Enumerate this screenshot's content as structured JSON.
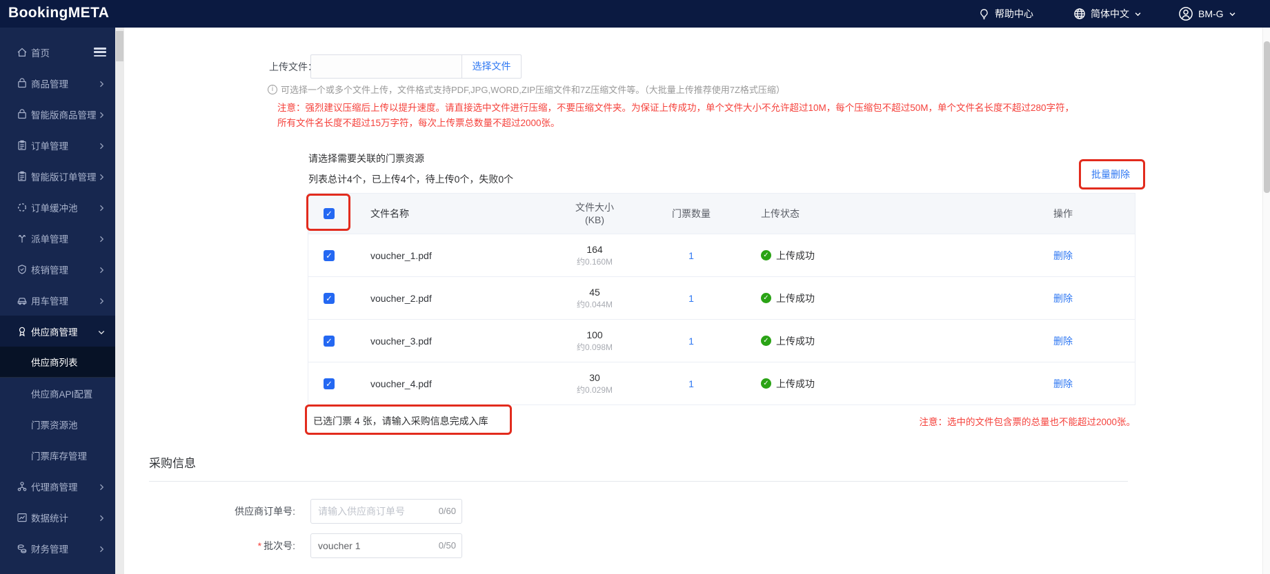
{
  "header": {
    "logo": "BookingMETA",
    "help_label": "帮助中心",
    "language_label": "简体中文",
    "user_label": "BM-G"
  },
  "sidebar": {
    "items": [
      {
        "label": "首页"
      },
      {
        "label": "商品管理"
      },
      {
        "label": "智能版商品管理"
      },
      {
        "label": "订单管理"
      },
      {
        "label": "智能版订单管理"
      },
      {
        "label": "订单缓冲池"
      },
      {
        "label": "派单管理"
      },
      {
        "label": "核销管理"
      },
      {
        "label": "用车管理"
      },
      {
        "label": "供应商管理"
      },
      {
        "label": "代理商管理"
      },
      {
        "label": "数据统计"
      },
      {
        "label": "财务管理"
      }
    ],
    "submenu": [
      {
        "label": "供应商列表"
      },
      {
        "label": "供应商API配置"
      },
      {
        "label": "门票资源池"
      },
      {
        "label": "门票库存管理"
      }
    ]
  },
  "upload": {
    "label": "上传文件：",
    "choose_button": "选择文件",
    "hint": "可选择一个或多个文件上传，文件格式支持PDF,JPG,WORD,ZIP压缩文件和7Z压缩文件等。（大批量上传推荐使用7Z格式压缩）",
    "warning_line1": "注意：强烈建议压缩后上传以提升速度。请直接选中文件进行压缩，不要压缩文件夹。为保证上传成功，单个文件大小不允许超过10M，每个压缩包不超过50M，单个文件名长度不超过280字符，",
    "warning_line2": "所有文件名长度不超过15万字符，每次上传票总数量不超过2000张。"
  },
  "resource": {
    "select_prompt": "请选择需要关联的门票资源",
    "summary": "列表总计4个，已上传4个，待上传0个，失败0个",
    "batch_delete": "批量删除",
    "columns": {
      "name": "文件名称",
      "size_line1": "文件大小",
      "size_line2": "(KB)",
      "qty": "门票数量",
      "status": "上传状态",
      "action": "操作"
    },
    "rows": [
      {
        "name": "voucher_1.pdf",
        "size_kb": "164",
        "size_m": "约0.160M",
        "qty": "1",
        "status": "上传成功",
        "action": "删除"
      },
      {
        "name": "voucher_2.pdf",
        "size_kb": "45",
        "size_m": "约0.044M",
        "qty": "1",
        "status": "上传成功",
        "action": "删除"
      },
      {
        "name": "voucher_3.pdf",
        "size_kb": "100",
        "size_m": "约0.098M",
        "qty": "1",
        "status": "上传成功",
        "action": "删除"
      },
      {
        "name": "voucher_4.pdf",
        "size_kb": "30",
        "size_m": "约0.029M",
        "qty": "1",
        "status": "上传成功",
        "action": "删除"
      }
    ],
    "selected_note": "已选门票 4 张，请输入采购信息完成入库",
    "limit_note": "注意：选中的文件包含票的总量也不能超过2000张。"
  },
  "purchase": {
    "section_title": "采购信息",
    "supplier_order": {
      "label": "供应商订单号:",
      "placeholder": "请输入供应商订单号",
      "counter": "0/60"
    },
    "batch": {
      "required_mark": "*",
      "label": "批次号:",
      "value": "voucher 1",
      "counter": "0/50"
    }
  },
  "colors": {
    "topbar": "#0b1a41",
    "sidebar": "#17274f",
    "accent_link": "#2e77f2",
    "warning_red": "#f5413b",
    "annotation_red": "#e22b1d",
    "success_green": "#2aa315"
  }
}
